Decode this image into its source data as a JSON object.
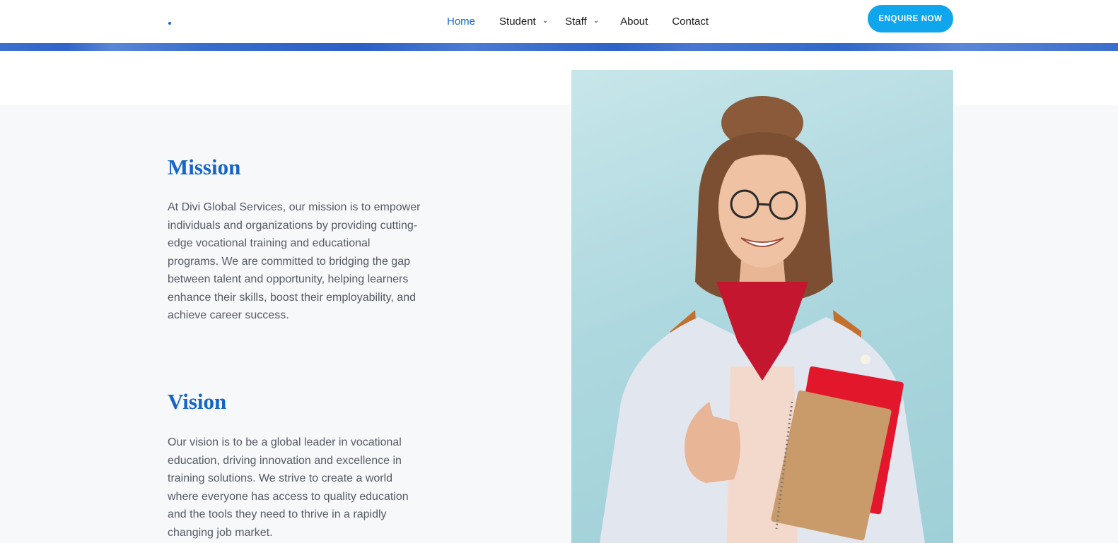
{
  "header": {
    "nav": [
      {
        "label": "Home",
        "active": true,
        "has_submenu": false
      },
      {
        "label": "Student",
        "active": false,
        "has_submenu": true
      },
      {
        "label": "Staff",
        "active": false,
        "has_submenu": true
      },
      {
        "label": "About",
        "active": false,
        "has_submenu": false
      },
      {
        "label": "Contact",
        "active": false,
        "has_submenu": false
      }
    ],
    "cta_label": "ENQUIRE NOW",
    "submenu_icon": "chevron-down-icon"
  },
  "mission": {
    "title": "Mission",
    "text": "At Divi Global Services, our mission is to empower individuals and organizations by providing cutting-edge vocational training and educational programs. We are committed to bridging the gap between talent and opportunity, helping learners enhance their skills, boost their employability, and achieve career success."
  },
  "vision": {
    "title": "Vision",
    "text": "Our vision is to be a global leader in vocational education, driving innovation and excellence in training solutions. We strive to create a world where everyone has access to quality education and the tools they need to thrive in a rapidly changing job market."
  },
  "colors": {
    "accent": "#1565c8",
    "cta": "#10a6ee",
    "band_background": "#f7f8fa",
    "body_text": "#555a63"
  }
}
